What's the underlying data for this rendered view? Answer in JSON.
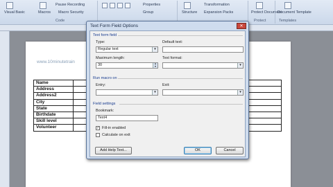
{
  "ribbon": {
    "visual_basic_label": "Visual Basic",
    "macros_label": "Macros",
    "pause_recording_label": "Pause Recording",
    "macro_security_label": "Macro Security",
    "code_group_label": "Code",
    "properties_label": "Properties",
    "group_label": "Group",
    "structure_label": "Structure",
    "transformation_label": "Transformation",
    "expansion_packs_label": "Expansion Packs",
    "protect_document_label": "Protect Document",
    "protect_group_label": "Protect",
    "document_template_label": "Document Template",
    "templates_group_label": "Templates"
  },
  "document": {
    "watermark_text": "www.10minutetrain",
    "table_rows": [
      "Name",
      "Address",
      "Address2",
      "City",
      "State",
      "Birthdate",
      "Skill level",
      "Volunteer"
    ]
  },
  "dialog": {
    "title": "Text Form Field Options",
    "section_text_form_field": "Text form field",
    "type_label": "Type:",
    "type_value": "Regular text",
    "default_text_label": "Default text:",
    "default_text_value": "",
    "max_length_label": "Maximum length:",
    "max_length_value": "30",
    "text_format_label": "Text format:",
    "text_format_value": "",
    "section_run_macro": "Run macro on",
    "entry_label": "Entry:",
    "entry_value": "",
    "exit_label": "Exit:",
    "exit_value": "",
    "section_field_settings": "Field settings",
    "bookmark_label": "Bookmark:",
    "bookmark_value": "Text4",
    "fill_in_enabled_label": "Fill-in enabled",
    "fill_in_enabled_checked": true,
    "calculate_on_exit_label": "Calculate on exit",
    "calculate_on_exit_checked": false,
    "add_help_text_label": "Add Help Text...",
    "ok_label": "OK",
    "cancel_label": "Cancel"
  }
}
